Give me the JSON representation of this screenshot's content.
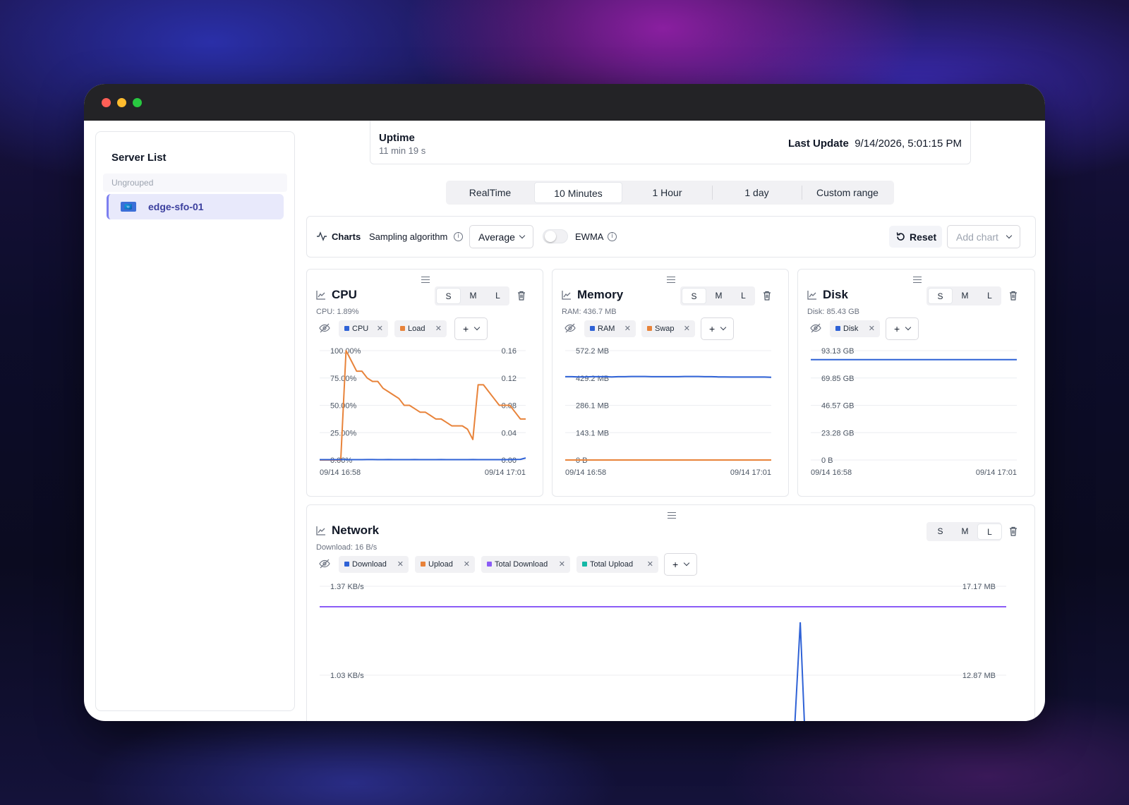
{
  "window": {
    "controls": [
      "close",
      "minimize",
      "maximize"
    ]
  },
  "sidebar": {
    "title": "Server List",
    "group": "Ungrouped",
    "server": {
      "name": "edge-sfo-01",
      "flag": "🇺🇳"
    }
  },
  "summary": {
    "uptime_label": "Uptime",
    "uptime_value": "11 min 19 s",
    "last_update_label": "Last Update",
    "last_update_value": "9/14/2026, 5:01:15 PM"
  },
  "range_tabs": [
    {
      "label": "RealTime"
    },
    {
      "label": "10 Minutes",
      "active": true
    },
    {
      "label": "1 Hour"
    },
    {
      "label": "1 day"
    },
    {
      "label": "Custom range"
    }
  ],
  "toolbar": {
    "charts_label": "Charts",
    "sampling_label": "Sampling algorithm",
    "sampling_value": "Average",
    "ewma_label": "EWMA",
    "ewma_on": false,
    "reset_label": "Reset",
    "add_chart_label": "Add chart"
  },
  "size_buttons": [
    "S",
    "M",
    "L"
  ],
  "cards": {
    "cpu": {
      "title": "CPU",
      "stat": "CPU: 1.89%",
      "size": "S",
      "series": [
        "CPU",
        "Load"
      ]
    },
    "memory": {
      "title": "Memory",
      "stat": "RAM: 436.7 MB",
      "size": "S",
      "series": [
        "RAM",
        "Swap"
      ]
    },
    "disk": {
      "title": "Disk",
      "stat": "Disk: 85.43 GB",
      "size": "S",
      "series": [
        "Disk"
      ]
    },
    "network": {
      "title": "Network",
      "stat": "Download: 16 B/s",
      "size": "L",
      "series": [
        "Download",
        "Upload",
        "Total Download",
        "Total Upload"
      ]
    }
  },
  "colors": {
    "blue": "#2f62d6",
    "orange": "#e8833a",
    "purple": "#8b5cf6",
    "teal": "#14b8a6"
  },
  "chart_data": [
    {
      "type": "line",
      "title": "CPU",
      "x_ticks": [
        "09/14 16:58",
        "09/14 17:01"
      ],
      "y_left": {
        "ticks": [
          "100.00%",
          "75.00%",
          "50.00%",
          "25.00%",
          "0.00%"
        ],
        "range": [
          0,
          100
        ]
      },
      "y_right": {
        "ticks": [
          "0.16",
          "0.12",
          "0.08",
          "0.04",
          "0.00"
        ],
        "range": [
          0,
          0.16
        ]
      },
      "series": [
        {
          "name": "CPU",
          "axis": "left",
          "color": "#2f62d6",
          "values": [
            0.3,
            0.3,
            0.3,
            0.3,
            0.4,
            0.4,
            0.3,
            0.3,
            0.3,
            0.4,
            0.4,
            0.3,
            0.3,
            0.4,
            0.3,
            0.3,
            0.3,
            0.3,
            0.4,
            0.3,
            0.3,
            0.3,
            0.3,
            0.4,
            0.3,
            0.3,
            0.3,
            0.3,
            0.3,
            0.4,
            0.3,
            0.3,
            0.3,
            0.3,
            0.3,
            0.3,
            0.4,
            0.5,
            0.6,
            1.9
          ]
        },
        {
          "name": "Load",
          "axis": "right",
          "color": "#e8833a",
          "values": [
            0,
            0,
            0,
            0,
            0,
            0.16,
            0.145,
            0.13,
            0.13,
            0.12,
            0.115,
            0.115,
            0.105,
            0.1,
            0.095,
            0.09,
            0.08,
            0.08,
            0.075,
            0.07,
            0.07,
            0.065,
            0.06,
            0.06,
            0.055,
            0.05,
            0.05,
            0.05,
            0.045,
            0.03,
            0.11,
            0.11,
            0.1,
            0.09,
            0.08,
            0.08,
            0.08,
            0.07,
            0.06,
            0.06
          ]
        }
      ]
    },
    {
      "type": "line",
      "title": "Memory",
      "x_ticks": [
        "09/14 16:58",
        "09/14 17:01"
      ],
      "y_left": {
        "ticks": [
          "572.2 MB",
          "429.2 MB",
          "286.1 MB",
          "143.1 MB",
          "0 B"
        ],
        "range": [
          0,
          572.2
        ]
      },
      "series": [
        {
          "name": "RAM",
          "color": "#2f62d6",
          "values": [
            436,
            436,
            435,
            435,
            436,
            436,
            436,
            435,
            436,
            436,
            437,
            437,
            437,
            436,
            436,
            436,
            436,
            436,
            437,
            437,
            437,
            436,
            436,
            435,
            435,
            434,
            434,
            434,
            434,
            434,
            434,
            433
          ]
        },
        {
          "name": "Swap",
          "color": "#e8833a",
          "values": [
            0,
            0,
            0,
            0,
            0,
            0,
            0,
            0,
            0,
            0,
            0,
            0,
            0,
            0,
            0,
            0,
            0,
            0,
            0,
            0,
            0,
            0,
            0,
            0,
            0,
            0,
            0,
            0,
            0,
            0,
            0,
            0
          ]
        }
      ]
    },
    {
      "type": "line",
      "title": "Disk",
      "x_ticks": [
        "09/14 16:58",
        "09/14 17:01"
      ],
      "y_left": {
        "ticks": [
          "93.13 GB",
          "69.85 GB",
          "46.57 GB",
          "23.28 GB",
          "0 B"
        ],
        "range": [
          0,
          93.13
        ]
      },
      "series": [
        {
          "name": "Disk",
          "color": "#2f62d6",
          "values": [
            85.43,
            85.43,
            85.43,
            85.43,
            85.43,
            85.43,
            85.43,
            85.43,
            85.43,
            85.43
          ]
        }
      ]
    },
    {
      "type": "line",
      "title": "Network",
      "x_ticks": [],
      "y_left": {
        "ticks": [
          "1.37 KB/s",
          "1.03 KB/s"
        ]
      },
      "y_right": {
        "ticks": [
          "17.17 MB",
          "12.87 MB"
        ]
      },
      "series": [
        {
          "name": "Download",
          "color": "#2f62d6",
          "spike_position": 0.7
        },
        {
          "name": "Upload",
          "color": "#e8833a"
        },
        {
          "name": "Total Download",
          "color": "#8b5cf6"
        },
        {
          "name": "Total Upload",
          "color": "#14b8a6"
        }
      ]
    }
  ]
}
